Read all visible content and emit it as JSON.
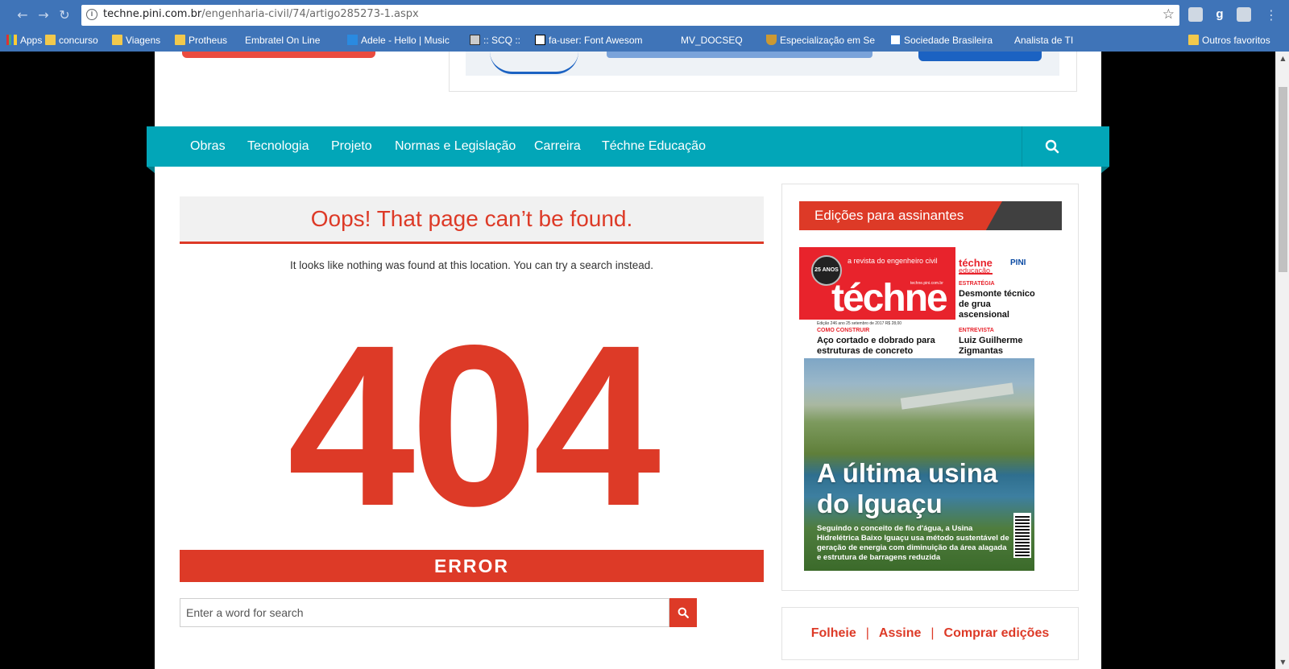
{
  "browser": {
    "url_host": "techne.pini.com.br",
    "url_path": "/engenharia-civil/74/artigo285273-1.aspx",
    "ext_g_label": "g",
    "bookmarks": [
      {
        "label": "Apps",
        "icon": "apps-grid-icon"
      },
      {
        "label": "concurso",
        "icon": "folder-icon"
      },
      {
        "label": "Viagens",
        "icon": "folder-icon"
      },
      {
        "label": "Protheus",
        "icon": "folder-icon"
      },
      {
        "label": "Embratel On Line",
        "icon": "page-icon"
      },
      {
        "label": "Adele - Hello | Music",
        "icon": "flash-icon"
      },
      {
        "label": ":: SCQ ::",
        "icon": "x-icon"
      },
      {
        "label": "fa-user: Font Awesom",
        "icon": "flag-icon"
      },
      {
        "label": "",
        "icon": "page-icon"
      },
      {
        "label": "MV_DOCSEQ",
        "icon": "page-icon"
      },
      {
        "label": "Especialização em Se",
        "icon": "shield-icon"
      },
      {
        "label": "Sociedade Brasileira",
        "icon": "screen-icon"
      },
      {
        "label": "Analista de TI",
        "icon": "page-icon"
      },
      {
        "label": "",
        "icon": "page-icon"
      },
      {
        "label": "",
        "icon": "page-icon"
      },
      {
        "label": "Outros favoritos",
        "icon": "folder-icon"
      }
    ]
  },
  "nav": {
    "items": [
      "Obras",
      "Tecnologia",
      "Projeto",
      "Normas e Legislação",
      "Carreira",
      "Téchne Educação"
    ],
    "search_icon": "search-icon"
  },
  "main": {
    "title": "Oops! That page can’t be found.",
    "message": "It looks like nothing was found at this location. You can try a search instead.",
    "code": "404",
    "error_label": "ERROR",
    "search_placeholder": "Enter a word for search"
  },
  "sidebar": {
    "title": "Edições para assinantes",
    "cover": {
      "badge": "25 ANOS",
      "tagline": "a revista do engenheiro civil",
      "url": "techne.pini.com.br",
      "logo": "téchne",
      "edition": "Edição 246 ano 25 setembro de 2017 R$ 28,00",
      "small_logo_1": "téchne",
      "small_logo_2": "educação",
      "pini": "PINI",
      "k1": "ESTRATÉGIA",
      "h1": "Desmonte técnico de grua ascensional",
      "k2": "COMO CONSTRUIR",
      "h2": "Aço cortado e dobrado para estruturas de concreto",
      "k3": "ENTREVISTA",
      "h3": "Luiz Guilherme Zigmantas",
      "big1": "A última usina",
      "big2": "do Iguaçu",
      "desc": "Seguindo o conceito de fio d'água, a Usina Hidrelétrica Baixo Iguaçu usa método sustentável de geração de energia com diminuição da área alagada e estrutura de barragens reduzida"
    },
    "links": [
      "Folheie",
      "Assine",
      "Comprar edições"
    ],
    "separator": "|"
  },
  "colors": {
    "accent": "#dd3a27",
    "nav": "#02a6b8",
    "chrome": "#3f74b8"
  }
}
